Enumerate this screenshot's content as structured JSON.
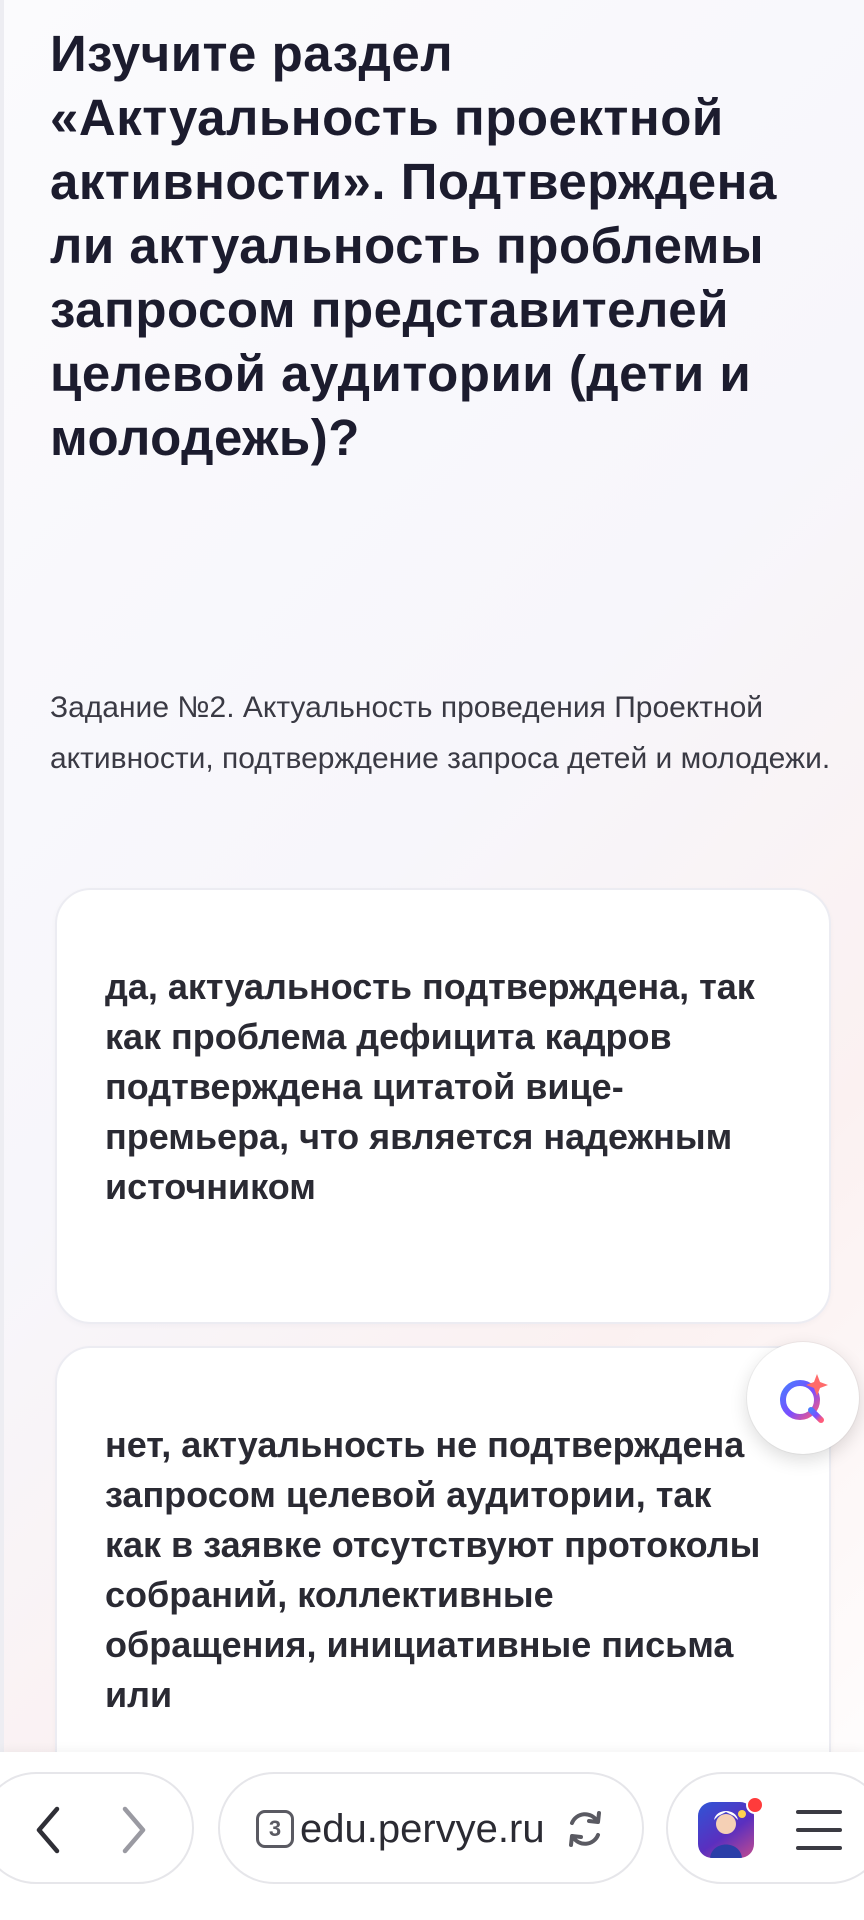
{
  "question": {
    "title": "Изучите раздел «Актуальность проектной активности». Подтверждена ли актуальность проблемы запросом представителей целевой аудитории (дети и молодежь)?",
    "task_description": "Задание №2. Актуальность проведения Проектной активности, подтверждение запроса детей и молодежи."
  },
  "options": [
    {
      "text": "да, актуальность подтверждена, так как проблема дефицита кадров подтверждена цитатой вице-премьера, что является надежным источником"
    },
    {
      "text": "нет, актуальность не подтверждена запросом целевой аудитории, так как в заявке отсутствуют протоколы собраний, коллективные обращения, инициативные письма или"
    }
  ],
  "assistant": {
    "icon": "assistant-logo-icon"
  },
  "browser": {
    "tab_count": "3",
    "url": "edu.pervye.ru",
    "icons": {
      "back": "chevron-left-icon",
      "forward": "chevron-right-icon",
      "reload": "reload-icon",
      "app": "app-shortcut-icon",
      "menu": "hamburger-menu-icon"
    }
  }
}
